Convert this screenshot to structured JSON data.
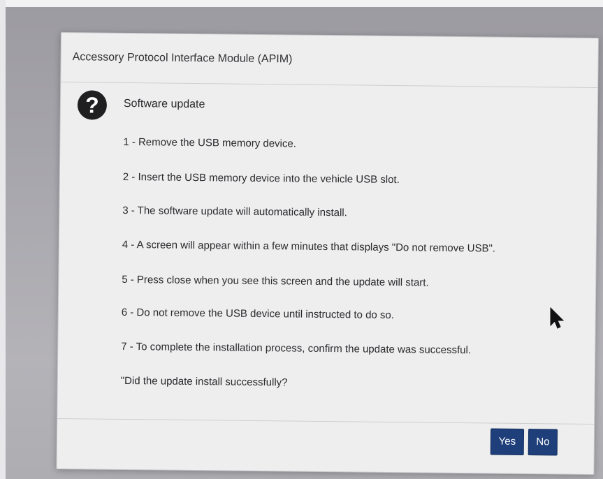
{
  "dialog": {
    "title": "Accessory Protocol Interface Module (APIM)",
    "heading": "Software update",
    "icon": "question-icon",
    "steps": [
      "1 - Remove the USB memory device.",
      "2 - Insert the USB memory device into the vehicle USB slot.",
      "3 - The software update will automatically install.",
      "4 - A screen will appear within a few minutes that displays \"Do not remove USB\".",
      "5 - Press close when you see this screen and the update will start.",
      "6 - Do not remove the USB device until instructed to do so.",
      "7 - To complete the installation process, confirm the update was successful."
    ],
    "question": "\"Did the update install successfully?",
    "buttons": {
      "yes_label": "Yes",
      "no_label": "No"
    }
  },
  "colors": {
    "button_bg": "#1e3f7a",
    "dialog_bg": "#eeeeef",
    "screen_bg": "#a9a8ae"
  }
}
